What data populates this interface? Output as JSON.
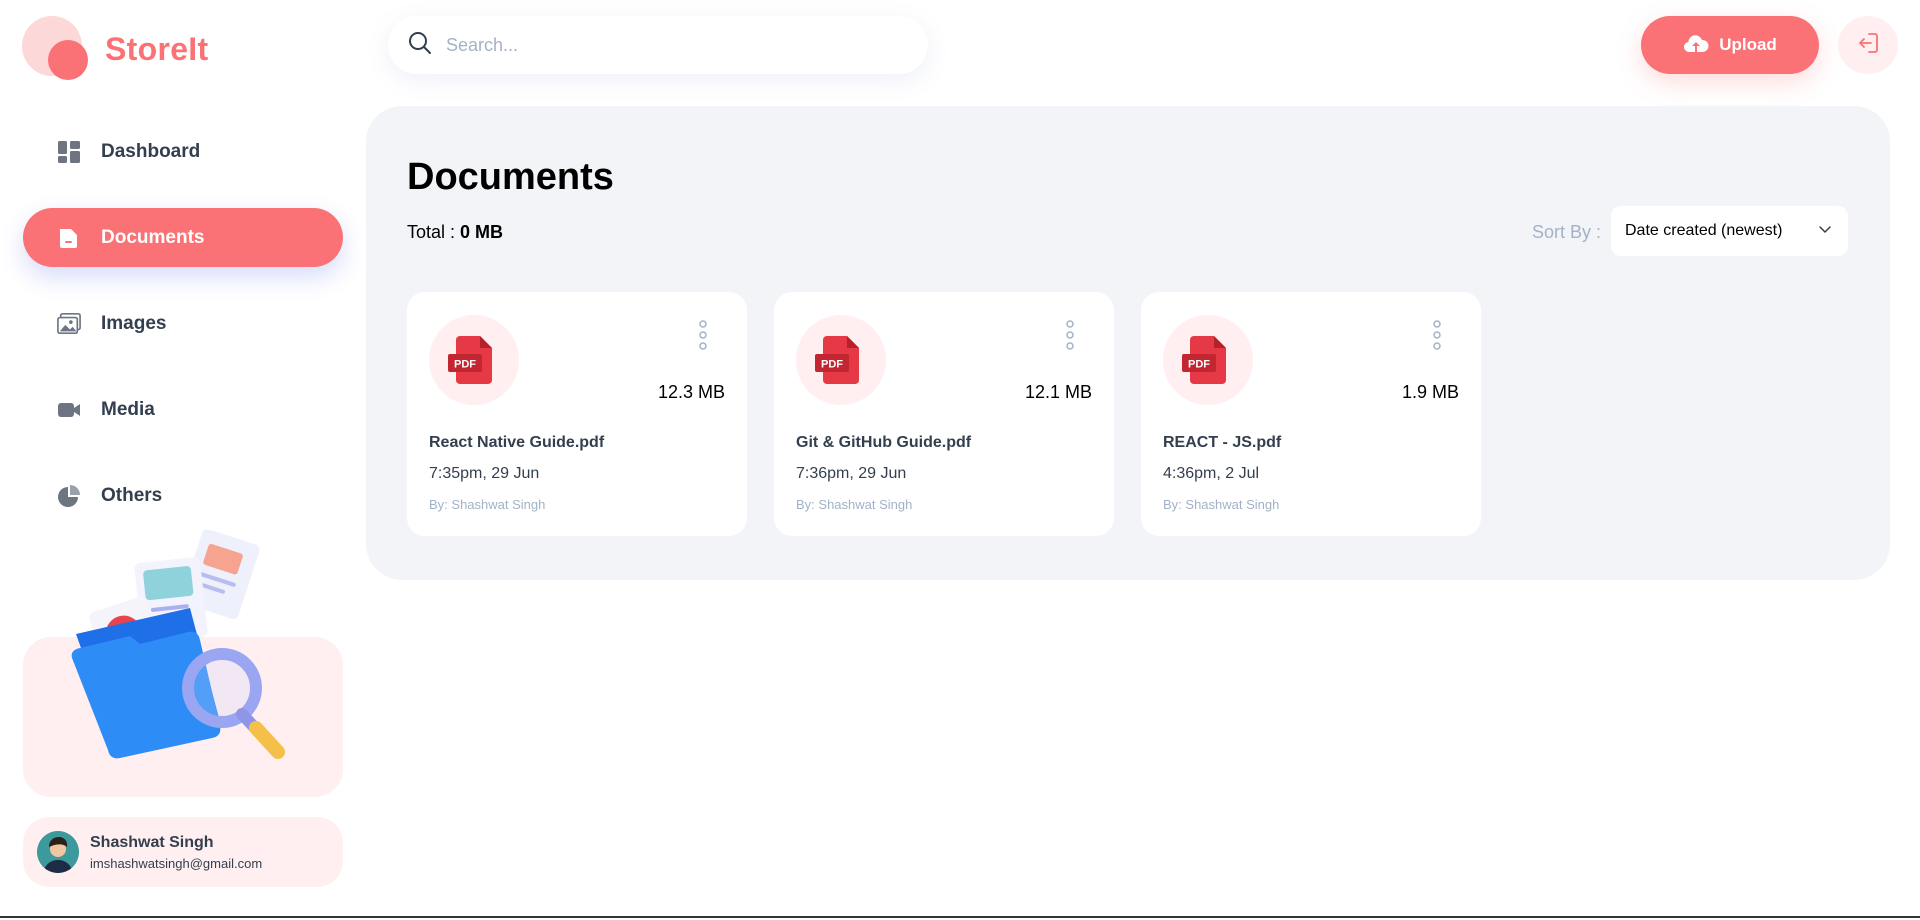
{
  "brand": {
    "name": "StoreIt"
  },
  "colors": {
    "brand": "#FA7275",
    "brand_light": "#FFEFF0",
    "text": "#333F4E",
    "muted": "#A3B2C7",
    "main_bg": "#F2F4F8"
  },
  "sidebar": {
    "items": [
      {
        "label": "Dashboard",
        "icon": "dashboard-icon",
        "active": false
      },
      {
        "label": "Documents",
        "icon": "documents-icon",
        "active": true
      },
      {
        "label": "Images",
        "icon": "images-icon",
        "active": false
      },
      {
        "label": "Media",
        "icon": "media-icon",
        "active": false
      },
      {
        "label": "Others",
        "icon": "others-icon",
        "active": false
      }
    ]
  },
  "user": {
    "name": "Shashwat Singh",
    "email": "imshashwatsingh@gmail.com"
  },
  "header": {
    "search_placeholder": "Search...",
    "upload_label": "Upload"
  },
  "page": {
    "title": "Documents",
    "total_label": "Total :",
    "total_value": "0 MB",
    "sort_label": "Sort By :",
    "sort_value": "Date created (newest)"
  },
  "files": [
    {
      "name": "React Native Guide.pdf",
      "size": "12.3 MB",
      "date": "7:35pm, 29 Jun",
      "by": "By: Shashwat Singh",
      "badge": "PDF"
    },
    {
      "name": "Git & GitHub Guide.pdf",
      "size": "12.1 MB",
      "date": "7:36pm, 29 Jun",
      "by": "By: Shashwat Singh",
      "badge": "PDF"
    },
    {
      "name": "REACT - JS.pdf",
      "size": "1.9 MB",
      "date": "4:36pm, 2 Jul",
      "by": "By: Shashwat Singh",
      "badge": "PDF"
    }
  ]
}
